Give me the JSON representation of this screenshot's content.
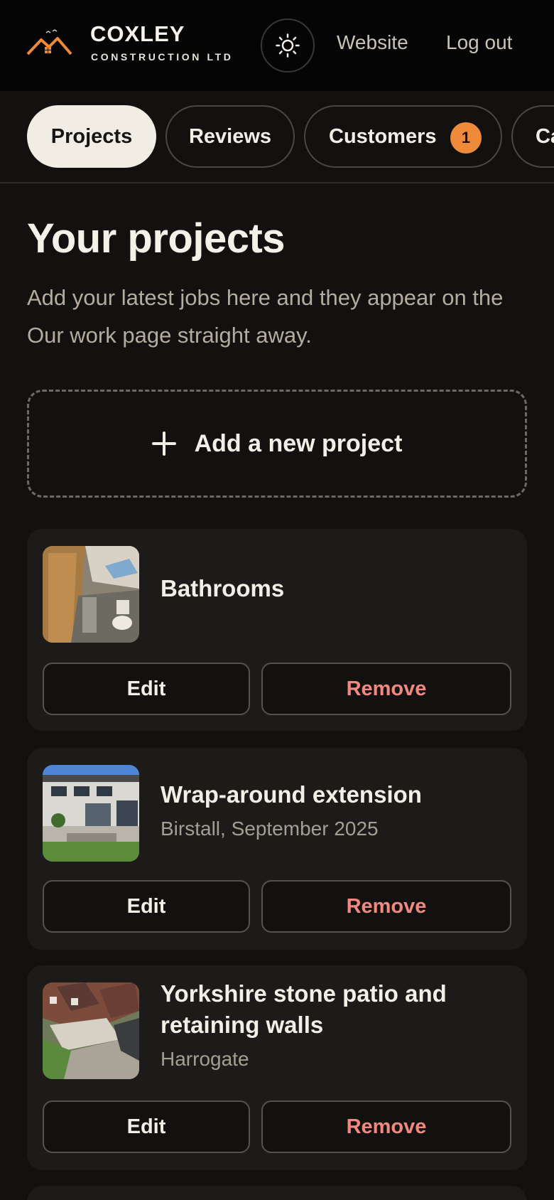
{
  "header": {
    "brand_name": "COXLEY",
    "brand_sub": "CONSTRUCTION LTD",
    "website_label": "Website",
    "logout_label": "Log out",
    "accent": "#ee8a3a"
  },
  "tabs": [
    {
      "label": "Projects",
      "active": true
    },
    {
      "label": "Reviews"
    },
    {
      "label": "Customers",
      "badge": "1"
    },
    {
      "label": "Ca"
    }
  ],
  "main": {
    "title": "Your projects",
    "description": "Add your latest jobs here and they appear on the Our work page straight away.",
    "add_label": "Add a new project"
  },
  "projects": [
    {
      "title": "Bathrooms",
      "subtitle": "",
      "edit_label": "Edit",
      "remove_label": "Remove"
    },
    {
      "title": "Wrap-around extension",
      "subtitle": "Birstall, September 2025",
      "edit_label": "Edit",
      "remove_label": "Remove"
    },
    {
      "title": "Yorkshire stone patio and retaining walls",
      "subtitle": "Harrogate",
      "edit_label": "Edit",
      "remove_label": "Remove"
    }
  ]
}
